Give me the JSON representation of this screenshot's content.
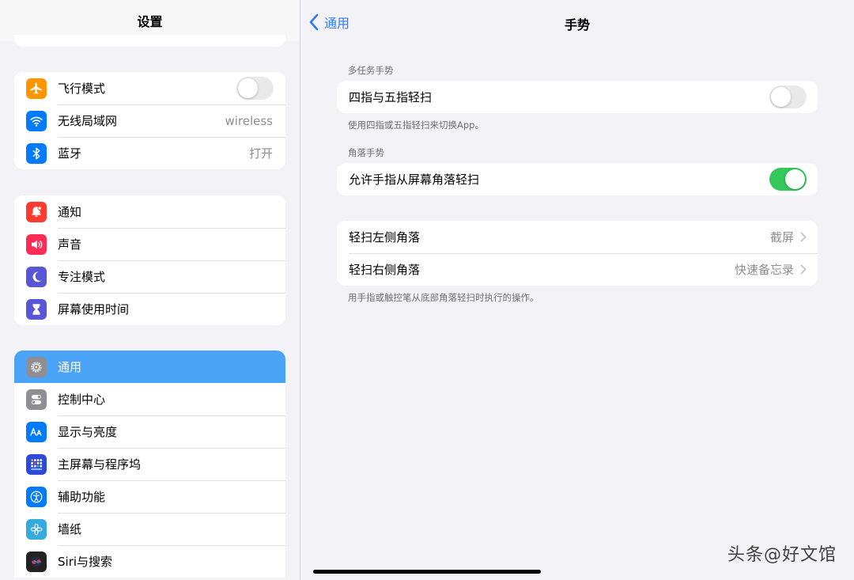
{
  "sidebar": {
    "title": "设置",
    "groups": [
      {
        "items": [
          {
            "label": "飞行模式",
            "icon": "airplane-icon",
            "color": "#ff9500",
            "toggle": false
          },
          {
            "label": "无线局域网",
            "icon": "wifi-icon",
            "color": "#007aff",
            "value": "wireless"
          },
          {
            "label": "蓝牙",
            "icon": "bluetooth-icon",
            "color": "#007aff",
            "value": "打开"
          }
        ]
      },
      {
        "items": [
          {
            "label": "通知",
            "icon": "notification-bell-icon",
            "color": "#ff3b30"
          },
          {
            "label": "声音",
            "icon": "speaker-icon",
            "color": "#ff2d55"
          },
          {
            "label": "专注模式",
            "icon": "moon-icon",
            "color": "#5856d6"
          },
          {
            "label": "屏幕使用时间",
            "icon": "hourglass-icon",
            "color": "#5856d6"
          }
        ]
      },
      {
        "items": [
          {
            "label": "通用",
            "icon": "gear-icon",
            "color": "#8e8e93",
            "selected": true
          },
          {
            "label": "控制中心",
            "icon": "toggles-icon",
            "color": "#8e8e93"
          },
          {
            "label": "显示与亮度",
            "icon": "text-size-icon",
            "color": "#007aff"
          },
          {
            "label": "主屏幕与程序坞",
            "icon": "app-grid-icon",
            "color": "#2d49d8"
          },
          {
            "label": "辅助功能",
            "icon": "accessibility-icon",
            "color": "#007aff"
          },
          {
            "label": "墙纸",
            "icon": "flower-icon",
            "color": "#35aadc"
          },
          {
            "label": "Siri与搜索",
            "icon": "siri-icon",
            "color": "#222222"
          }
        ]
      }
    ]
  },
  "detail": {
    "back_label": "通用",
    "title": "手势",
    "multitask_header": "多任务手势",
    "four_five_label": "四指与五指轻扫",
    "four_five_toggle": false,
    "multitask_footer": "使用四指或五指轻扫来切换App。",
    "corner_header": "角落手势",
    "corner_swipe_label": "允许手指从屏幕角落轻扫",
    "corner_swipe_toggle": true,
    "left_corner_label": "轻扫左侧角落",
    "left_corner_value": "截屏",
    "right_corner_label": "轻扫右侧角落",
    "right_corner_value": "快速备忘录",
    "corner_footer": "用手指或触控笔从底部角落轻扫时执行的操作。"
  },
  "watermark": "头条@好文馆",
  "colors": {
    "accent": "#2f7cf6",
    "selected_row": "#4ba3f7",
    "toggle_on": "#34c759",
    "toggle_off": "#e9e9ea"
  }
}
